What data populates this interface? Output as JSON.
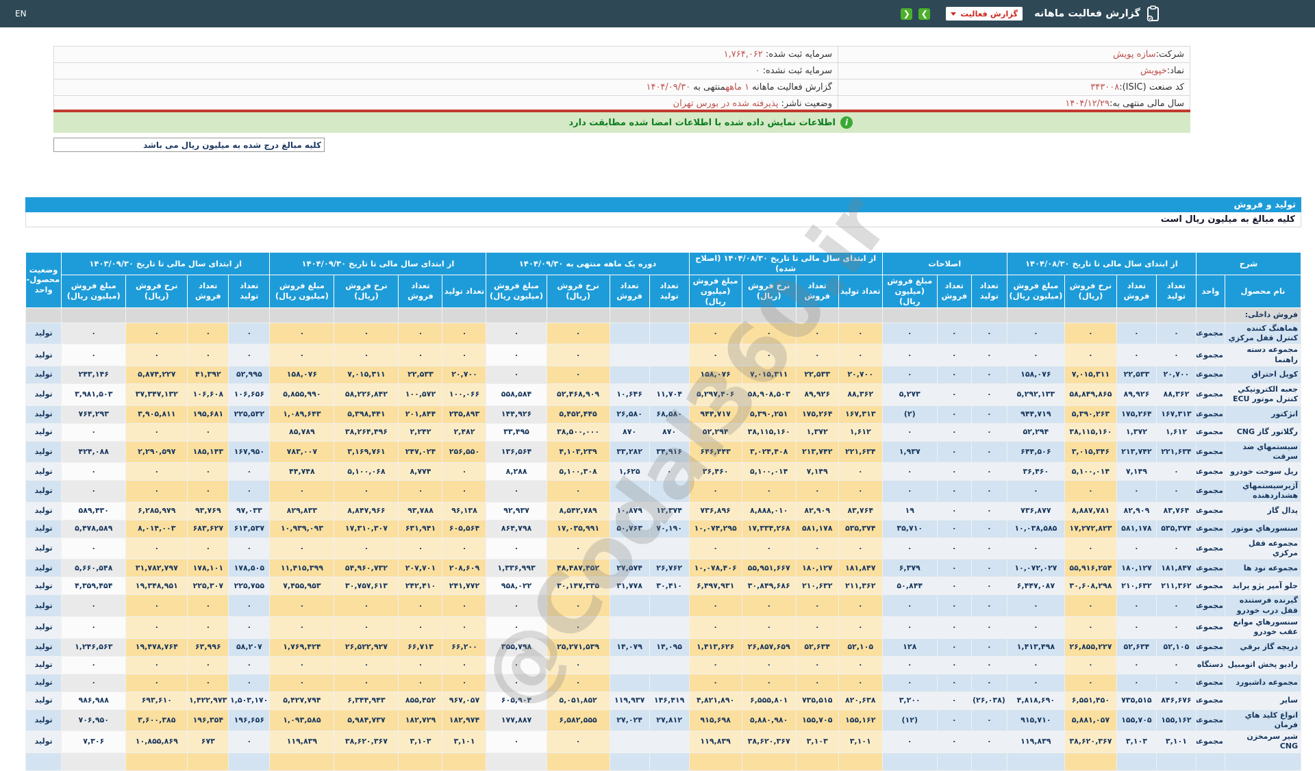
{
  "navbar": {
    "en_label": "EN",
    "title": "گزارش فعالیت ماهانه",
    "dropdown_label": "گزارش فعالیت",
    "prev_button": "❮",
    "next_button": "❯"
  },
  "colors": {
    "navbar_bg": "#2e4856",
    "header_blue": "#1e9cd9",
    "green_button": "#4db02d",
    "accent_value": "#c0504d",
    "notice_bg": "#d6e9c6",
    "notice_text": "#0a7d20",
    "red_line": "#c23b2e"
  },
  "company_info": {
    "rows": [
      {
        "right": [
          {
            "t": "شرکت: ",
            "c": "label"
          },
          {
            "t": "سازه پویش",
            "c": "value"
          }
        ],
        "left": [
          {
            "t": "سرمایه ثبت شده: ",
            "c": "label"
          },
          {
            "t": "۱,۷۶۴,۰۶۲",
            "c": "value"
          }
        ]
      },
      {
        "right": [
          {
            "t": "نماد: ",
            "c": "label"
          },
          {
            "t": "خپویش",
            "c": "value"
          }
        ],
        "left": [
          {
            "t": "سرمایه ثبت نشده: ",
            "c": "label"
          },
          {
            "t": "۰",
            "c": "value"
          }
        ]
      },
      {
        "right": [
          {
            "t": "کد صنعت (ISIC): ",
            "c": "label"
          },
          {
            "t": "۳۴۳۰۰۸",
            "c": "value"
          }
        ],
        "left": [
          {
            "t": "گزارش فعالیت ماهانه ",
            "c": "label"
          },
          {
            "t": "۱ ماهه",
            "c": "value"
          },
          {
            "t": "منتهی به ",
            "c": "label"
          },
          {
            "t": "۱۴۰۴/۰۹/۳۰",
            "c": "value"
          }
        ]
      },
      {
        "right": [
          {
            "t": "سال مالی منتهی به: ",
            "c": "label"
          },
          {
            "t": "۱۴۰۴/۱۲/۲۹",
            "c": "value"
          }
        ],
        "left": [
          {
            "t": "وضعیت ناشر: ",
            "c": "label"
          },
          {
            "t": "پذیرفته شده در بورس تهران",
            "c": "value"
          }
        ]
      }
    ]
  },
  "notice_text": "اطلاعات نمایش داده شده با اطلاعات امضا شده مطابقت دارد",
  "amounts_note": "کلیه مبالغ درج شده به میلیون ریال می باشد",
  "section": {
    "title": "تولید و فروش",
    "subtitle": "کلیه مبالغ به میلیون ریال است"
  },
  "watermark": "@Codal360.ir",
  "table": {
    "groups": [
      {
        "label": "شرح",
        "colspan": 2
      },
      {
        "label": "از ابتدای سال مالی تا تاریخ ۱۴۰۴/۰۸/۳۰",
        "colspan": 4
      },
      {
        "label": "اصلاحات",
        "colspan": 3
      },
      {
        "label": "از ابتدای سال مالی تا تاریخ ۱۴۰۴/۰۸/۳۰ (اصلاح شده)",
        "colspan": 4
      },
      {
        "label": "دوره یک ماهه منتهی به ۱۴۰۴/۰۹/۳۰",
        "colspan": 4
      },
      {
        "label": "از ابتدای سال مالی تا تاریخ ۱۴۰۴/۰۹/۳۰",
        "colspan": 4
      },
      {
        "label": "از ابتدای سال مالی تا تاریخ ۱۴۰۳/۰۹/۳۰",
        "colspan": 4
      },
      {
        "label": "وضعیت محصول-واحد",
        "rowspan": 2
      }
    ],
    "sub_columns": [
      "نام محصول",
      "واحد",
      "تعداد تولید",
      "تعداد فروش",
      "نرخ فروش (ریال)",
      "مبلغ فروش (میلیون ریال)",
      "تعداد تولید",
      "تعداد فروش",
      "مبلغ فروش (میلیون ریال)",
      "تعداد تولید",
      "تعداد فروش",
      "نرخ فروش (ریال)",
      "مبلغ فروش (میلیون ریال)",
      "تعداد تولید",
      "تعداد فروش",
      "نرخ فروش (ریال)",
      "مبلغ فروش (میلیون ریال)",
      "تعداد تولید",
      "تعداد فروش",
      "نرخ فروش (ریال)",
      "مبلغ فروش (میلیون ریال)",
      "تعداد تولید",
      "تعداد فروش",
      "نرخ فروش (ریال)",
      "مبلغ فروش (میلیون ریال)"
    ],
    "rows": [
      {
        "section": "فروش داخلی:"
      },
      {
        "name": "هماهنگ کننده کنترل قفل مرکزي",
        "unit": "مجموعه",
        "status": "تولید",
        "vals": [
          "۰",
          "۰",
          "۰",
          "۰",
          "۰",
          "۰",
          "۰",
          "۰",
          "۰",
          "۰",
          "۰",
          "",
          "",
          "۰",
          "۰",
          "۰",
          "۰",
          "۰",
          "۰",
          "۰",
          "۰",
          "۰",
          "۰"
        ]
      },
      {
        "name": "مجموعه دسته راهنما",
        "unit": "مجموعه",
        "status": "تولید",
        "vals": [
          "۰",
          "۰",
          "۰",
          "۰",
          "۰",
          "۰",
          "۰",
          "۰",
          "۰",
          "۰",
          "۰",
          "",
          "",
          "۰",
          "۰",
          "۰",
          "۰",
          "۰",
          "۰",
          "۰",
          "۰",
          "۰",
          "۰"
        ]
      },
      {
        "name": "کویل احتراق",
        "unit": "مجموعه",
        "status": "تولید",
        "vals": [
          "۲۰,۷۰۰",
          "۲۲,۵۳۳",
          "۷,۰۱۵,۳۱۱",
          "۱۵۸,۰۷۶",
          "۰",
          "۰",
          "۰",
          "۲۰,۷۰۰",
          "۲۲,۵۳۳",
          "۷,۰۱۵,۳۱۱",
          "۱۵۸,۰۷۶",
          "",
          "",
          "۰",
          "۰",
          "۲۰,۷۰۰",
          "۲۲,۵۳۳",
          "۷,۰۱۵,۳۱۱",
          "۱۵۸,۰۷۶",
          "۵۲,۹۹۵",
          "۴۱,۳۹۲",
          "۵,۸۷۴,۲۲۷",
          "۲۴۳,۱۴۶"
        ]
      },
      {
        "name": "جعبه الکترونیکي کنترل موتور ECU",
        "unit": "مجموعه",
        "status": "تولید",
        "vals": [
          "۸۸,۳۶۲",
          "۸۹,۹۲۶",
          "۵۸,۸۴۹,۸۶۵",
          "۵,۲۹۲,۱۳۳",
          "۰",
          "۰",
          "۵,۲۷۳",
          "۸۸,۳۶۲",
          "۸۹,۹۲۶",
          "۵۸,۹۰۸,۵۰۳",
          "۵,۲۹۷,۴۰۶",
          "۱۱,۷۰۴",
          "۱۰,۶۴۶",
          "۵۲,۴۶۸,۹۰۹",
          "۵۵۸,۵۸۴",
          "۱۰۰,۰۶۶",
          "۱۰۰,۵۷۲",
          "۵۸,۲۲۶,۸۴۲",
          "۵,۸۵۵,۹۹۰",
          "۱۰۶,۶۵۶",
          "۱۰۶,۶۰۸",
          "۳۷,۳۴۷,۱۳۲",
          "۳,۹۸۱,۵۰۳"
        ]
      },
      {
        "name": "انژکتور",
        "unit": "مجموعه",
        "status": "تولید",
        "vals": [
          "۱۶۷,۳۱۳",
          "۱۷۵,۲۶۴",
          "۵,۳۹۰,۲۶۳",
          "۹۴۴,۷۱۹",
          "۰",
          "۰",
          "(۲)",
          "۱۶۷,۳۱۳",
          "۱۷۵,۲۶۴",
          "۵,۳۹۰,۲۵۱",
          "۹۴۴,۷۱۷",
          "۶۸,۵۸۰",
          "۲۶,۵۸۰",
          "۵,۴۵۲,۴۴۵",
          "۱۴۴,۹۲۶",
          "۲۳۵,۸۹۳",
          "۲۰۱,۸۴۴",
          "۵,۳۹۸,۴۴۱",
          "۱,۰۸۹,۶۴۳",
          "۲۲۵,۵۳۲",
          "۱۹۵,۶۸۱",
          "۳,۹۰۵,۸۱۱",
          "۷۶۴,۲۹۳"
        ]
      },
      {
        "name": "رگلاتور گاز CNG",
        "unit": "مجموعه",
        "status": "تولید",
        "vals": [
          "۱,۶۱۲",
          "۱,۳۷۲",
          "۳۸,۱۱۵,۱۶۰",
          "۵۲,۲۹۴",
          "۰",
          "۰",
          "۰",
          "۱,۶۱۲",
          "۱,۳۷۲",
          "۳۸,۱۱۵,۱۶۰",
          "۵۲,۲۹۴",
          "۸۷۰",
          "۸۷۰",
          "۳۸,۵۰۰,۰۰۰",
          "۳۳,۴۹۵",
          "۲,۴۸۲",
          "۲,۲۴۲",
          "۳۸,۲۶۴,۴۹۶",
          "۸۵,۷۸۹",
          "",
          "۰",
          "۰",
          "۰"
        ]
      },
      {
        "name": "سیستمهاي ضد سرقت",
        "unit": "مجموعه",
        "status": "تولید",
        "vals": [
          "۲۲۱,۶۳۴",
          "۲۱۳,۷۴۲",
          "۳,۰۱۵,۳۴۶",
          "۶۴۴,۵۰۶",
          "۰",
          "۰",
          "۱,۹۳۷",
          "۲۲۱,۶۳۴",
          "۲۱۳,۷۴۲",
          "۳,۰۲۴,۴۰۸",
          "۶۴۶,۴۴۳",
          "۳۴,۹۱۶",
          "۳۳,۲۸۲",
          "۴,۱۰۳,۲۳۹",
          "۱۳۶,۵۶۴",
          "۲۵۶,۵۵۰",
          "۲۴۷,۰۲۴",
          "۳,۱۶۹,۷۶۱",
          "۷۸۳,۰۰۷",
          "۱۶۷,۹۵۰",
          "۱۸۵,۱۴۳",
          "۲,۲۹۰,۵۹۷",
          "۴۲۴,۰۸۸"
        ]
      },
      {
        "name": "ریل سوخت خودرو",
        "unit": "مجموعه",
        "status": "تولید",
        "vals": [
          "۰",
          "۷,۱۴۹",
          "۵,۱۰۰,۰۱۴",
          "۳۶,۴۶۰",
          "۰",
          "۰",
          "۰",
          "۰",
          "۷,۱۴۹",
          "۵,۱۰۰,۰۱۴",
          "۳۶,۴۶۰",
          "۰",
          "۱,۶۲۵",
          "۵,۱۰۰,۳۰۸",
          "۸,۲۸۸",
          "۰",
          "۸,۷۷۴",
          "۵,۱۰۰,۰۶۸",
          "۴۴,۷۴۸",
          "۰",
          "۰",
          "۰",
          "۰"
        ]
      },
      {
        "name": "آژیرسیستمهاي هشداردهنده",
        "unit": "مجموعه",
        "status": "تولید",
        "vals": [
          "۰",
          "۰",
          "۰",
          "۰",
          "۰",
          "۰",
          "۰",
          "۰",
          "۰",
          "۰",
          "۰",
          "",
          "",
          "۰",
          "۰",
          "۰",
          "۰",
          "۰",
          "۰",
          "۰",
          "۰",
          "۰",
          "۰"
        ]
      },
      {
        "name": "پدال گاز",
        "unit": "مجموعه",
        "status": "تولید",
        "vals": [
          "۸۳,۷۶۴",
          "۸۲,۹۰۹",
          "۸,۸۸۷,۷۸۱",
          "۷۳۶,۸۷۷",
          "۰",
          "۰",
          "۱۹",
          "۸۳,۷۶۴",
          "۸۲,۹۰۹",
          "۸,۸۸۸,۰۱۰",
          "۷۳۶,۸۹۶",
          "۱۲,۳۷۴",
          "۱۰,۸۷۹",
          "۸,۵۴۲,۷۸۹",
          "۹۲,۹۳۷",
          "۹۶,۱۳۸",
          "۹۳,۷۸۸",
          "۸,۸۴۷,۹۶۶",
          "۸۲۹,۸۳۳",
          "۹۷,۰۳۳",
          "۹۳,۷۶۹",
          "۶,۲۸۵,۹۷۹",
          "۵۸۹,۴۳۰"
        ]
      },
      {
        "name": "سنسورهاي موتور",
        "unit": "مجموعه",
        "status": "تولید",
        "vals": [
          "۵۳۵,۳۷۴",
          "۵۸۱,۱۷۸",
          "۱۷,۲۷۲,۸۲۳",
          "۱۰,۰۳۸,۵۸۵",
          "۰",
          "۰",
          "۳۵,۷۱۰",
          "۵۳۵,۳۷۴",
          "۵۸۱,۱۷۸",
          "۱۷,۳۳۴,۲۶۸",
          "۱۰,۰۷۴,۲۹۵",
          "۷۰,۱۹۰",
          "۵۰,۷۶۳",
          "۱۷,۰۳۵,۹۹۱",
          "۸۶۴,۷۹۸",
          "۶۰۵,۵۶۴",
          "۶۳۱,۹۴۱",
          "۱۷,۳۱۰,۳۰۷",
          "۱۰,۹۳۹,۰۹۳",
          "۶۱۴,۵۳۷",
          "۶۸۳,۶۲۷",
          "۸,۰۱۴,۰۰۳",
          "۵,۴۷۸,۵۸۹"
        ]
      },
      {
        "name": "مجموعه قفل مرکزي",
        "unit": "مجموعه",
        "status": "تولید",
        "vals": [
          "۰",
          "۰",
          "۰",
          "۰",
          "۰",
          "۰",
          "۰",
          "۰",
          "۰",
          "۰",
          "۰",
          "",
          "",
          "۰",
          "۰",
          "۰",
          "۰",
          "۰",
          "۰",
          "۰",
          "۰",
          "۰",
          "۰"
        ]
      },
      {
        "name": "مجموعه نود ها",
        "unit": "مجموعه",
        "status": "تولید",
        "vals": [
          "۱۸۱,۸۴۷",
          "۱۸۰,۱۲۷",
          "۵۵,۹۱۶,۲۵۴",
          "۱۰,۰۷۲,۰۲۷",
          "۰",
          "۰",
          "۶,۳۷۹",
          "۱۸۱,۸۴۷",
          "۱۸۰,۱۲۷",
          "۵۵,۹۵۱,۶۶۷",
          "۱۰,۰۷۸,۴۰۶",
          "۲۶,۷۶۲",
          "۲۷,۵۷۴",
          "۴۸,۴۸۷,۴۵۲",
          "۱,۳۳۶,۹۹۳",
          "۲۰۸,۶۰۹",
          "۲۰۷,۷۰۱",
          "۵۴,۹۶۰,۷۳۲",
          "۱۱,۴۱۵,۳۹۹",
          "۱۷۸,۵۰۵",
          "۱۷۸,۱۰۱",
          "۳۱,۷۸۲,۷۹۷",
          "۵,۶۶۰,۵۴۸"
        ]
      },
      {
        "name": "جلو آمپر پژو پراید",
        "unit": "مجموعه",
        "status": "تولید",
        "vals": [
          "۲۱۱,۳۶۲",
          "۲۱۰,۶۳۲",
          "۳۰,۶۰۸,۲۹۸",
          "۶,۴۴۷,۰۸۷",
          "۰",
          "۰",
          "۵۰,۸۴۴",
          "۲۱۱,۳۶۲",
          "۲۱۰,۶۳۲",
          "۳۰,۸۴۹,۶۸۶",
          "۶,۴۹۷,۹۳۱",
          "۳۰,۴۱۰",
          "۳۱,۷۷۸",
          "۳۰,۱۴۷,۳۳۵",
          "۹۵۸,۰۲۲",
          "۲۴۱,۷۷۲",
          "۲۴۲,۴۱۰",
          "۳۰,۷۵۷,۶۱۳",
          "۷,۴۵۵,۹۵۳",
          "۲۲۵,۷۵۵",
          "۲۲۵,۳۰۷",
          "۱۹,۳۴۸,۹۵۱",
          "۴,۳۵۹,۴۵۴"
        ]
      },
      {
        "name": "گیرنده فرستنده قفل درب خودرو",
        "unit": "مجموعه",
        "status": "تولید",
        "vals": [
          "۰",
          "۰",
          "۰",
          "۰",
          "۰",
          "۰",
          "۰",
          "۰",
          "۰",
          "۰",
          "۰",
          "",
          "",
          "۰",
          "۰",
          "۰",
          "۰",
          "۰",
          "۰",
          "۰",
          "۰",
          "۰",
          "۰"
        ]
      },
      {
        "name": "سنسورهاي موانع عقب خودرو",
        "unit": "مجموعه",
        "status": "تولید",
        "vals": [
          "۰",
          "۰",
          "۰",
          "۰",
          "۰",
          "۰",
          "۰",
          "۰",
          "۰",
          "۰",
          "۰",
          "",
          "",
          "۰",
          "۰",
          "۰",
          "۰",
          "۰",
          "۰",
          "۰",
          "۰",
          "۰",
          "۰"
        ]
      },
      {
        "name": "دریچه گاز برقي",
        "unit": "مجموعه",
        "status": "تولید",
        "vals": [
          "۵۲,۱۰۵",
          "۵۲,۶۳۴",
          "۲۶,۸۵۵,۲۲۷",
          "۱,۴۱۳,۴۹۸",
          "۰",
          "۰",
          "۱۲۸",
          "۵۲,۱۰۵",
          "۵۲,۶۳۴",
          "۲۶,۸۵۷,۶۵۹",
          "۱,۴۱۳,۶۲۶",
          "۱۴,۰۹۵",
          "۱۴,۰۷۹",
          "۲۵,۲۷۱,۵۳۹",
          "۳۵۵,۷۹۸",
          "۶۶,۲۰۰",
          "۶۶,۷۱۳",
          "۲۶,۵۲۲,۹۲۷",
          "۱,۷۶۹,۴۲۴",
          "۵۸,۲۰۷",
          "۶۳,۹۹۶",
          "۱۹,۴۷۸,۷۶۴",
          "۱,۲۴۶,۵۶۳"
        ]
      },
      {
        "name": "رادیو پخش اتومبیل",
        "unit": "دستگاه",
        "status": "تولید",
        "vals": [
          "۰",
          "۰",
          "۰",
          "۰",
          "۰",
          "۰",
          "۰",
          "۰",
          "۰",
          "۰",
          "۰",
          "",
          "",
          "۰",
          "۰",
          "۰",
          "۰",
          "۰",
          "۰",
          "۰",
          "۰",
          "۰",
          "۰"
        ]
      },
      {
        "name": "مجموعه داشبورد",
        "unit": "مجموعه",
        "status": "تولید",
        "vals": [
          "۰",
          "۰",
          "۰",
          "۰",
          "۰",
          "۰",
          "۰",
          "۰",
          "۰",
          "۰",
          "۰",
          "",
          "",
          "۰",
          "۰",
          "۰",
          "۰",
          "۰",
          "۰",
          "۰",
          "۰",
          "۰",
          "۰"
        ]
      },
      {
        "name": "سایر",
        "unit": "مجموعه",
        "status": "تولید",
        "vals": [
          "۸۴۶,۶۷۶",
          "۷۳۵,۵۱۵",
          "۶,۵۵۱,۴۵۰",
          "۴,۸۱۸,۶۹۰",
          "(۲۶,۰۳۸)",
          "۰",
          "۳,۲۰۰",
          "۸۲۰,۶۳۸",
          "۷۳۵,۵۱۵",
          "۶,۵۵۵,۸۰۱",
          "۴,۸۲۱,۸۹۰",
          "۱۴۶,۴۱۹",
          "۱۱۹,۹۳۷",
          "۵,۰۵۱,۸۵۲",
          "۶۰۵,۹۰۴",
          "۹۶۷,۰۵۷",
          "۸۵۵,۴۵۲",
          "۶,۳۴۴,۹۴۳",
          "۵,۴۲۷,۷۹۴",
          "۱,۵۰۳,۱۷۰",
          "۱,۴۲۲,۹۷۳",
          "۶۹۳,۶۱۰",
          "۹۸۶,۹۸۸"
        ]
      },
      {
        "name": "انواع کلید هاي فرمان",
        "unit": "مجموعه",
        "status": "تولید",
        "vals": [
          "۱۵۵,۱۶۲",
          "۱۵۵,۷۰۵",
          "۵,۸۸۱,۰۵۷",
          "۹۱۵,۷۱۰",
          "۰",
          "۰",
          "(۱۲)",
          "۱۵۵,۱۶۲",
          "۱۵۵,۷۰۵",
          "۵,۸۸۰,۹۸۰",
          "۹۱۵,۶۹۸",
          "۲۷,۸۱۲",
          "۲۷,۰۲۴",
          "۶,۵۸۲,۵۵۵",
          "۱۷۷,۸۸۷",
          "۱۸۲,۹۷۴",
          "۱۸۲,۷۲۹",
          "۵,۹۸۴,۷۳۷",
          "۱,۰۹۳,۵۸۵",
          "۱۹۶,۶۵۶",
          "۱۹۶,۳۵۴",
          "۳,۶۰۰,۳۸۵",
          "۷۰۶,۹۵۰"
        ]
      },
      {
        "name": "شیر سرمخزن CNG",
        "unit": "مجموعه",
        "status": "تولید",
        "vals": [
          "۳,۱۰۱",
          "۳,۱۰۳",
          "۳۸,۶۲۰,۳۶۷",
          "۱۱۹,۸۳۹",
          "۰",
          "۰",
          "۰",
          "۳,۱۰۱",
          "۳,۱۰۳",
          "۳۸,۶۲۰,۳۶۷",
          "۱۱۹,۸۳۹",
          "",
          "",
          "۰",
          "۰",
          "۳,۱۰۱",
          "۳,۱۰۳",
          "۳۸,۶۲۰,۳۶۷",
          "۱۱۹,۸۳۹",
          "۰",
          "۶۷۳",
          "۱۰,۸۵۵,۸۶۹",
          "۷,۳۰۶"
        ]
      },
      {
        "name": "",
        "unit": "",
        "status": "",
        "vals": [
          "",
          "",
          "",
          "",
          "",
          "",
          "",
          "",
          "",
          "",
          "",
          "",
          "",
          "",
          "",
          "",
          "",
          "",
          "",
          "",
          "",
          "",
          ""
        ]
      }
    ]
  }
}
